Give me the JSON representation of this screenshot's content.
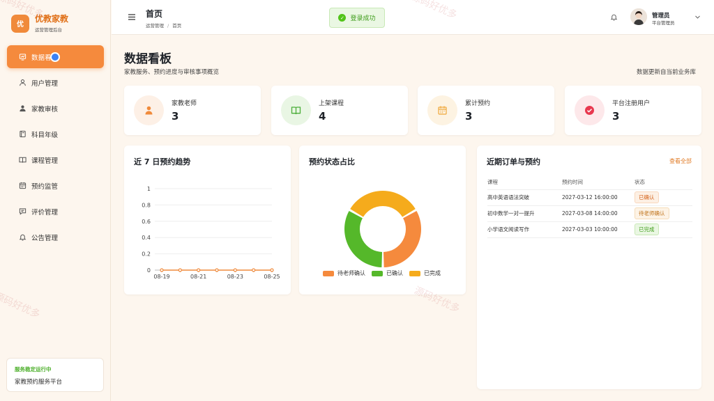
{
  "brand": {
    "logo_char": "优",
    "name": "优教家教",
    "subtitle": "运营管理后台"
  },
  "sidebar": {
    "items": [
      {
        "label": "数据看板",
        "icon": "dashboard-icon",
        "active": true
      },
      {
        "label": "用户管理",
        "icon": "user-icon"
      },
      {
        "label": "家教审核",
        "icon": "user-check-icon"
      },
      {
        "label": "科目年级",
        "icon": "book-icon"
      },
      {
        "label": "课程管理",
        "icon": "open-book-icon"
      },
      {
        "label": "预约监管",
        "icon": "calendar-icon"
      },
      {
        "label": "评价管理",
        "icon": "comment-icon"
      },
      {
        "label": "公告管理",
        "icon": "bell-icon"
      }
    ],
    "status": {
      "title": "服务稳定运行中",
      "desc": "家教预约服务平台"
    }
  },
  "header": {
    "title": "首页",
    "breadcrumb": [
      "运营管理",
      "首页"
    ],
    "toast": "登录成功",
    "user_name": "管理员",
    "user_role": "平台管理员"
  },
  "main": {
    "title": "数据看板",
    "subtitle": "家教服务、预约进度与审核事项概览",
    "note": "数据更新自当前业务库"
  },
  "stats": [
    {
      "label": "家教老师",
      "value": "3",
      "icon": "person-icon",
      "color": "#f08a3b",
      "bg": "#fdf0e6"
    },
    {
      "label": "上架课程",
      "value": "4",
      "icon": "book-open-icon",
      "color": "#4cae3a",
      "bg": "#e9f6e4"
    },
    {
      "label": "累计预约",
      "value": "3",
      "icon": "calendar-icon",
      "color": "#f0a83b",
      "bg": "#fdf3e2"
    },
    {
      "label": "平台注册用户",
      "value": "3",
      "icon": "check-circle-icon",
      "color": "#e8384f",
      "bg": "#fde8ea"
    }
  ],
  "trend": {
    "title": "近 7 日预约趋势",
    "chart_data": {
      "type": "line",
      "x": [
        "08-19",
        "08-20",
        "08-21",
        "08-22",
        "08-23",
        "08-24",
        "08-25"
      ],
      "x_tick_labels": [
        "08-19",
        "08-21",
        "08-23",
        "08-25"
      ],
      "series": [
        {
          "values": [
            0,
            0,
            0,
            0,
            0,
            0,
            0
          ]
        }
      ],
      "y_ticks": [
        "0",
        "0.2",
        "0.4",
        "0.6",
        "0.8",
        "1"
      ],
      "ylim": [
        0,
        1
      ],
      "grid": true,
      "color": "#f08a3b"
    }
  },
  "status_chart": {
    "title": "预约状态占比",
    "chart_data": {
      "type": "pie",
      "donut": true,
      "categories": [
        "待老师确认",
        "已确认",
        "已完成"
      ],
      "values": [
        1,
        1,
        1
      ],
      "colors": [
        "#f58a3d",
        "#55b82a",
        "#f5ab1c"
      ],
      "legend": "bottom"
    }
  },
  "orders": {
    "title": "近期订单与预约",
    "link": "查看全部",
    "columns": [
      "课程",
      "预约时间",
      "状态"
    ],
    "rows": [
      {
        "course": "高中英语语法突破",
        "time": "2027-03-12 16:00:00",
        "status": "已确认",
        "tag_color": "#d4621a",
        "tag_bg": "#fdf0e4"
      },
      {
        "course": "初中数学一对一提升",
        "time": "2027-03-08 14:00:00",
        "status": "待老师确认",
        "tag_color": "#c0731a",
        "tag_bg": "#fdf3e6"
      },
      {
        "course": "小学语文阅读写作",
        "time": "2027-03-03 10:00:00",
        "status": "已完成",
        "tag_color": "#3e9c1a",
        "tag_bg": "#eaf7e3"
      }
    ]
  },
  "watermark": "源码好优多"
}
